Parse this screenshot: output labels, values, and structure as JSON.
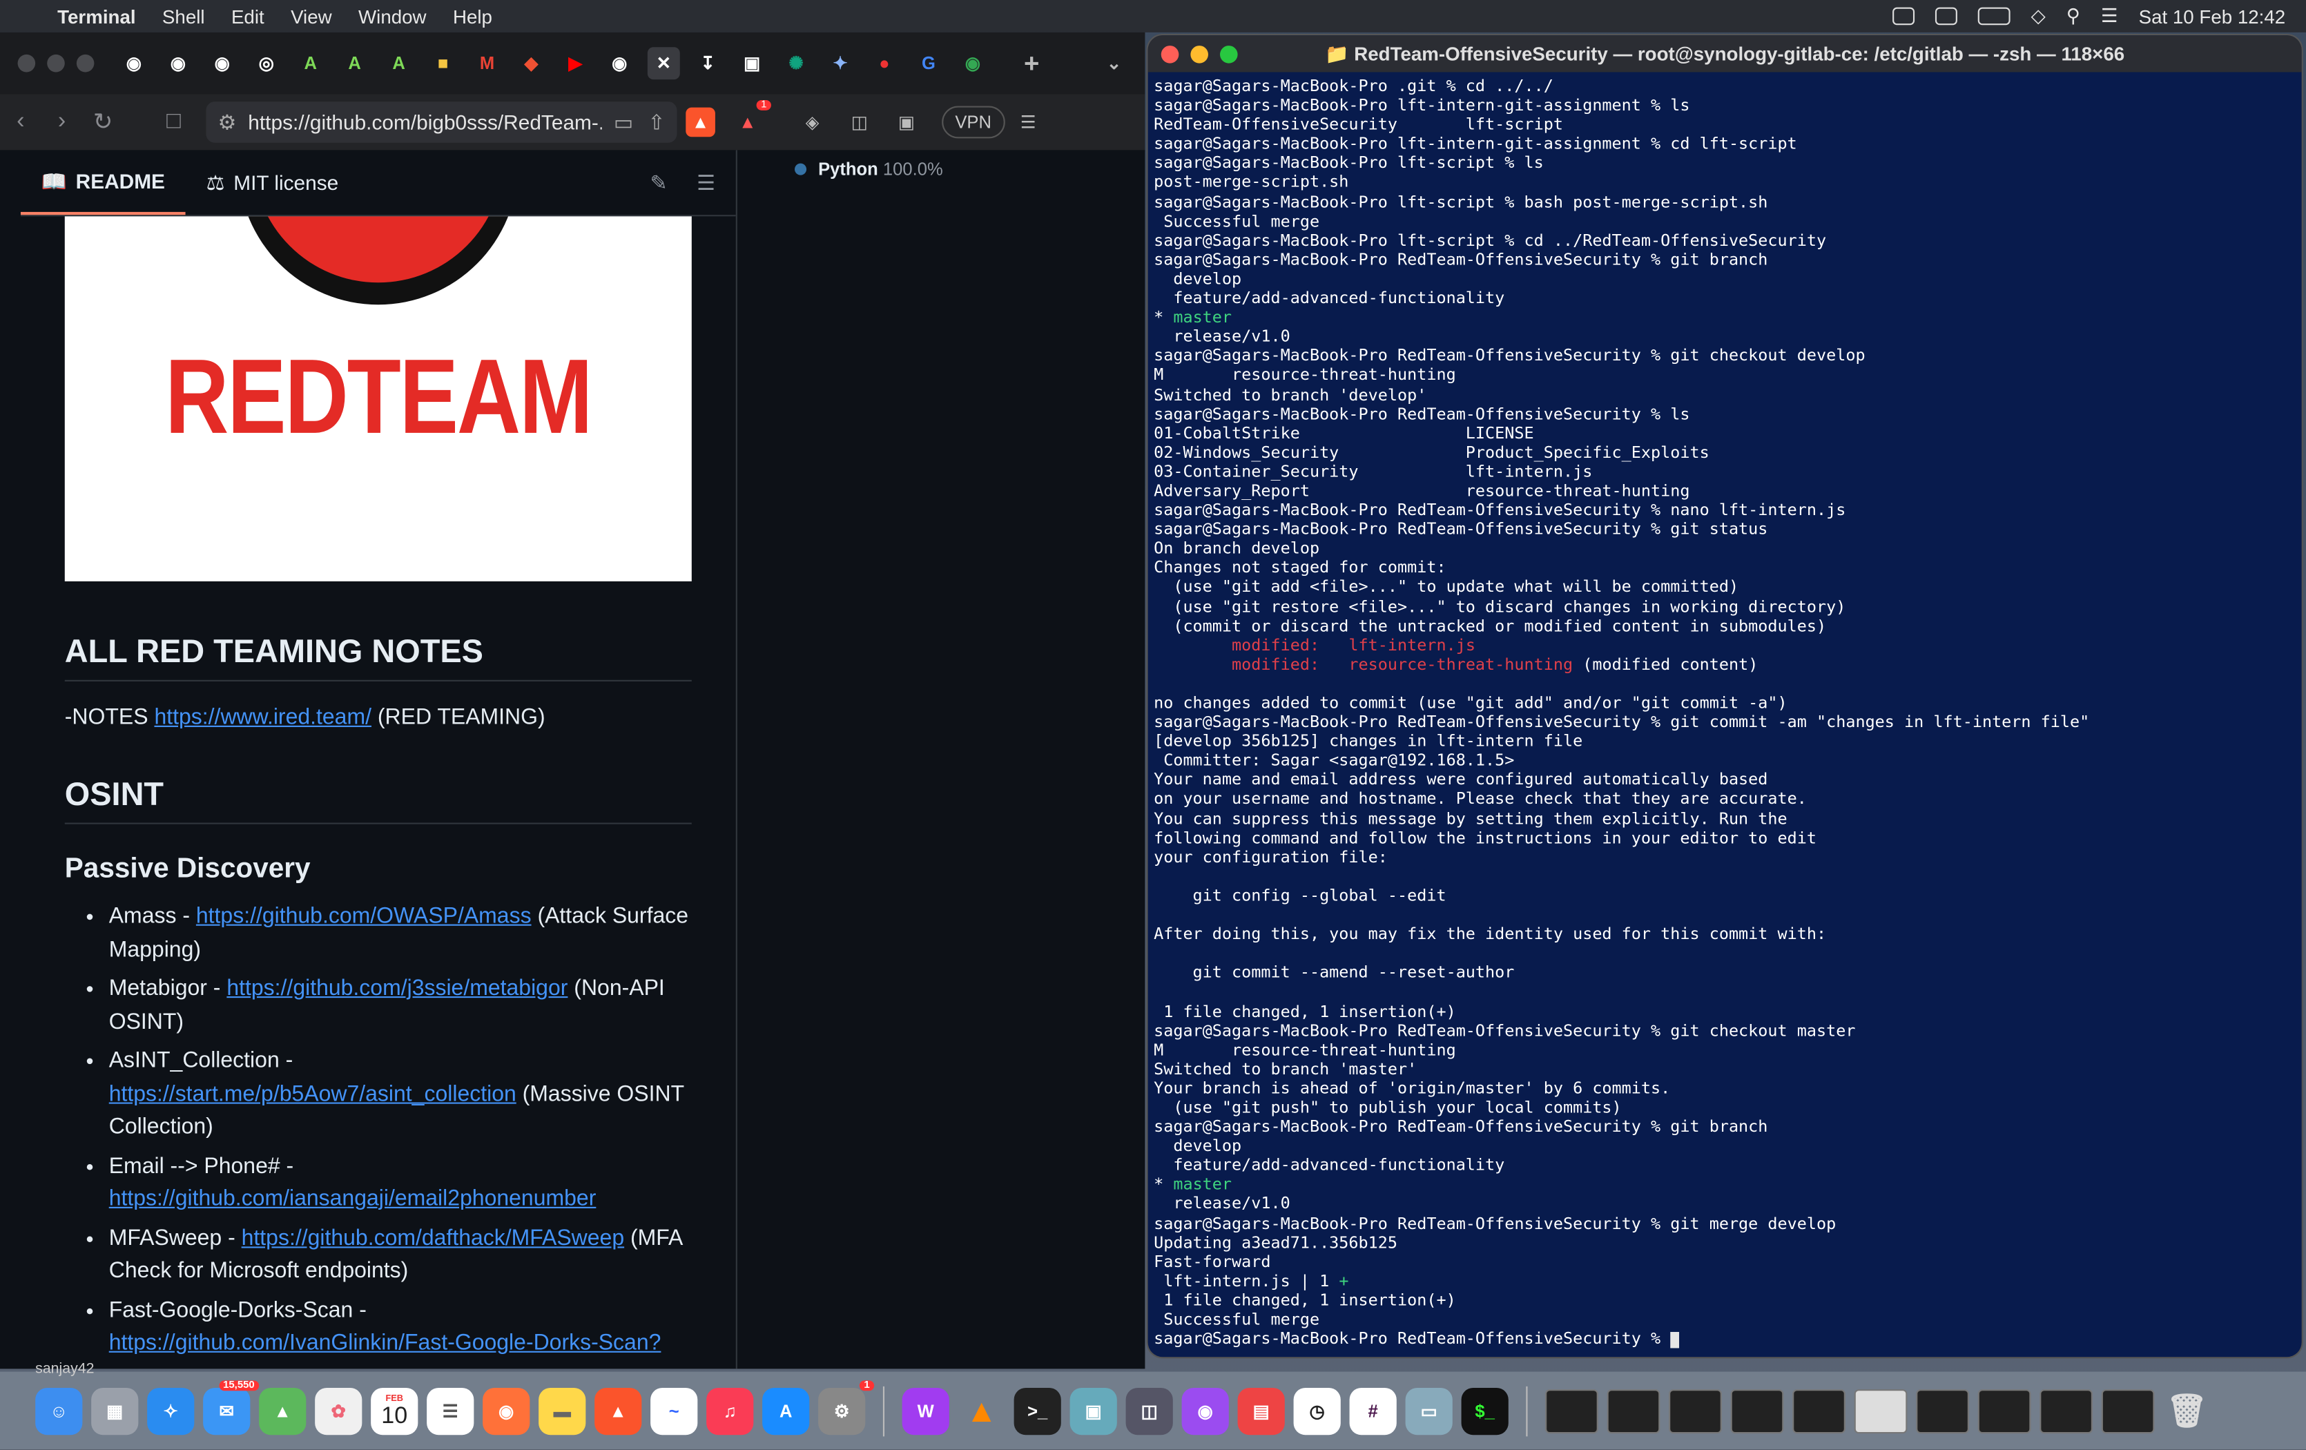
{
  "menubar": {
    "app": "Terminal",
    "items": [
      "Shell",
      "Edit",
      "View",
      "Window",
      "Help"
    ],
    "clock": "Sat 10 Feb  12:42"
  },
  "browser": {
    "url": "https://github.com/bigb0sss/RedTeam-...",
    "vpn_label": "VPN",
    "brave_badge": "1",
    "tabs_icons": [
      "github-icon",
      "github-icon",
      "github-icon",
      "icon",
      "A",
      "A",
      "A",
      "box",
      "M",
      "git",
      "yt",
      "github-icon",
      "close"
    ],
    "readme_tab": "README",
    "license_tab": "MIT license",
    "banner_word": "REDTEAM",
    "heading_notes": "ALL RED TEAMING NOTES",
    "notes_prefix": "-NOTES ",
    "notes_link": "https://www.ired.team/",
    "notes_suffix": " (RED TEAMING)",
    "heading_osint": "OSINT",
    "heading_passive": "Passive Discovery",
    "items": [
      {
        "name": "Amass - ",
        "link": "https://github.com/OWASP/Amass",
        "desc": " (Attack Surface Mapping)"
      },
      {
        "name": "Metabigor - ",
        "link": "https://github.com/j3ssie/metabigor",
        "desc": " (Non-API OSINT)"
      },
      {
        "name": "AsINT_Collection - ",
        "link": "https://start.me/p/b5Aow7/asint_collection",
        "desc": " (Massive OSINT Collection)"
      },
      {
        "name": "Email --> Phone# - ",
        "link": "https://github.com/iansangaji/email2phonenumber",
        "desc": ""
      },
      {
        "name": "MFASweep - ",
        "link": "https://github.com/dafthack/MFASweep",
        "desc": " (MFA Check for Microsoft endpoints)"
      },
      {
        "name": "Fast-Google-Dorks-Scan - ",
        "link": "https://github.com/IvanGlinkin/Fast-Google-Dorks-Scan?",
        "desc": ""
      }
    ],
    "language_name": "Python",
    "language_pct": "100.0%"
  },
  "terminal": {
    "title": "RedTeam-OffensiveSecurity — root@synology-gitlab-ce: /etc/gitlab — -zsh — 118×66",
    "lines": [
      {
        "t": "sagar@Sagars-MacBook-Pro .git % cd ../../"
      },
      {
        "t": "sagar@Sagars-MacBook-Pro lft-intern-git-assignment % ls"
      },
      {
        "t": "RedTeam-OffensiveSecurity       lft-script"
      },
      {
        "t": "sagar@Sagars-MacBook-Pro lft-intern-git-assignment % cd lft-script"
      },
      {
        "t": "sagar@Sagars-MacBook-Pro lft-script % ls"
      },
      {
        "t": "post-merge-script.sh"
      },
      {
        "t": "sagar@Sagars-MacBook-Pro lft-script % bash post-merge-script.sh"
      },
      {
        "t": " Successful merge"
      },
      {
        "t": "sagar@Sagars-MacBook-Pro lft-script % cd ../RedTeam-OffensiveSecurity"
      },
      {
        "t": "sagar@Sagars-MacBook-Pro RedTeam-OffensiveSecurity % git branch"
      },
      {
        "t": "  develop"
      },
      {
        "t": "  feature/add-advanced-functionality"
      },
      {
        "t": "* ",
        "g": "master"
      },
      {
        "t": "  release/v1.0"
      },
      {
        "t": "sagar@Sagars-MacBook-Pro RedTeam-OffensiveSecurity % git checkout develop"
      },
      {
        "t": "M       resource-threat-hunting"
      },
      {
        "t": "Switched to branch 'develop'"
      },
      {
        "t": "sagar@Sagars-MacBook-Pro RedTeam-OffensiveSecurity % ls"
      },
      {
        "t": "01-CobaltStrike                 LICENSE"
      },
      {
        "t": "02-Windows_Security             Product_Specific_Exploits"
      },
      {
        "t": "03-Container_Security           lft-intern.js"
      },
      {
        "t": "Adversary_Report                resource-threat-hunting"
      },
      {
        "t": "sagar@Sagars-MacBook-Pro RedTeam-OffensiveSecurity % nano lft-intern.js"
      },
      {
        "t": "sagar@Sagars-MacBook-Pro RedTeam-OffensiveSecurity % git status"
      },
      {
        "t": "On branch develop"
      },
      {
        "t": "Changes not staged for commit:"
      },
      {
        "t": "  (use \"git add <file>...\" to update what will be committed)"
      },
      {
        "t": "  (use \"git restore <file>...\" to discard changes in working directory)"
      },
      {
        "t": "  (commit or discard the untracked or modified content in submodules)"
      },
      {
        "t": "        ",
        "r": "modified:   lft-intern.js"
      },
      {
        "t": "        ",
        "r": "modified:   resource-threat-hunting",
        "s": " (modified content)"
      },
      {
        "t": ""
      },
      {
        "t": "no changes added to commit (use \"git add\" and/or \"git commit -a\")"
      },
      {
        "t": "sagar@Sagars-MacBook-Pro RedTeam-OffensiveSecurity % git commit -am \"changes in lft-intern file\""
      },
      {
        "t": "[develop 356b125] changes in lft-intern file"
      },
      {
        "t": " Committer: Sagar <sagar@192.168.1.5>"
      },
      {
        "t": "Your name and email address were configured automatically based"
      },
      {
        "t": "on your username and hostname. Please check that they are accurate."
      },
      {
        "t": "You can suppress this message by setting them explicitly. Run the"
      },
      {
        "t": "following command and follow the instructions in your editor to edit"
      },
      {
        "t": "your configuration file:"
      },
      {
        "t": ""
      },
      {
        "t": "    git config --global --edit"
      },
      {
        "t": ""
      },
      {
        "t": "After doing this, you may fix the identity used for this commit with:"
      },
      {
        "t": ""
      },
      {
        "t": "    git commit --amend --reset-author"
      },
      {
        "t": ""
      },
      {
        "t": " 1 file changed, 1 insertion(+)"
      },
      {
        "t": "sagar@Sagars-MacBook-Pro RedTeam-OffensiveSecurity % git checkout master"
      },
      {
        "t": "M       resource-threat-hunting"
      },
      {
        "t": "Switched to branch 'master'"
      },
      {
        "t": "Your branch is ahead of 'origin/master' by 6 commits."
      },
      {
        "t": "  (use \"git push\" to publish your local commits)"
      },
      {
        "t": "sagar@Sagars-MacBook-Pro RedTeam-OffensiveSecurity % git branch"
      },
      {
        "t": "  develop"
      },
      {
        "t": "  feature/add-advanced-functionality"
      },
      {
        "t": "* ",
        "g": "master"
      },
      {
        "t": "  release/v1.0"
      },
      {
        "t": "sagar@Sagars-MacBook-Pro RedTeam-OffensiveSecurity % git merge develop"
      },
      {
        "t": "Updating a3ead71..356b125"
      },
      {
        "t": "Fast-forward"
      },
      {
        "t": " lft-intern.js | 1 ",
        "g": "+"
      },
      {
        "t": " 1 file changed, 1 insertion(+)"
      },
      {
        "t": " Successful merge"
      },
      {
        "t": "sagar@Sagars-MacBook-Pro RedTeam-OffensiveSecurity % ",
        "c": true
      }
    ]
  },
  "dock": {
    "mail_badge": "15,550",
    "calendar_month": "FEB",
    "calendar_day": "10",
    "settings_badge": "1",
    "dock_label": "sanjay42",
    "apps": [
      "finder",
      "launchpad",
      "safari",
      "mail",
      "maps",
      "photos",
      "calendar",
      "reminders",
      "firefox",
      "notes",
      "brave",
      "freeform",
      "music",
      "appstore",
      "settings",
      "wps",
      "vlc",
      "terminal",
      "preview",
      "finder-files",
      "podcasts",
      "parallels",
      "clock",
      "slack",
      "display",
      "iterm"
    ]
  },
  "colors": {
    "terminal_bg": "#081b4d",
    "accent_red": "#e42b26",
    "link": "#4493f8"
  }
}
